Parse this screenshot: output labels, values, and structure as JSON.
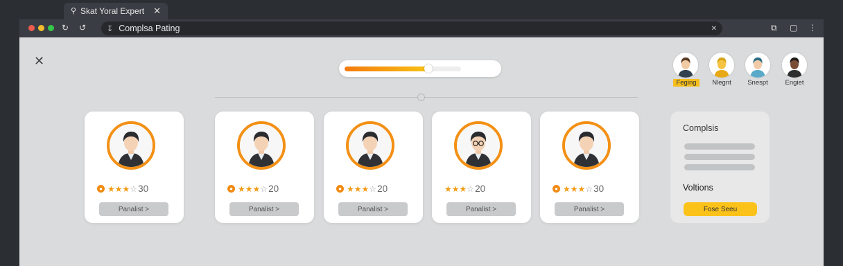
{
  "browser": {
    "tab_title": "Skat Yoral Expert",
    "url_text": "Complsa Pating"
  },
  "progress": {
    "fraction": 0.72
  },
  "panelists": [
    {
      "score": "30",
      "stars_filled": 3,
      "button": "Panalist >"
    },
    {
      "score": "20",
      "stars_filled": 3,
      "button": "Panalist >"
    },
    {
      "score": "20",
      "stars_filled": 3,
      "button": "Panalist >"
    },
    {
      "score": "20",
      "stars_filled": 3,
      "button": "Panalist >"
    },
    {
      "score": "30",
      "stars_filled": 3,
      "button": "Panalist >"
    }
  ],
  "side_panel": {
    "title": "Complsis",
    "subtitle": "Voltions",
    "button": "Fose Seeu"
  },
  "users": [
    {
      "label": "Feging",
      "active": true
    },
    {
      "label": "Nlegnt",
      "active": false
    },
    {
      "label": "Snespt",
      "active": false
    },
    {
      "label": "Engiet",
      "active": false
    }
  ],
  "colors": {
    "accent_orange": "#f39015",
    "accent_yellow": "#fbc21a"
  }
}
